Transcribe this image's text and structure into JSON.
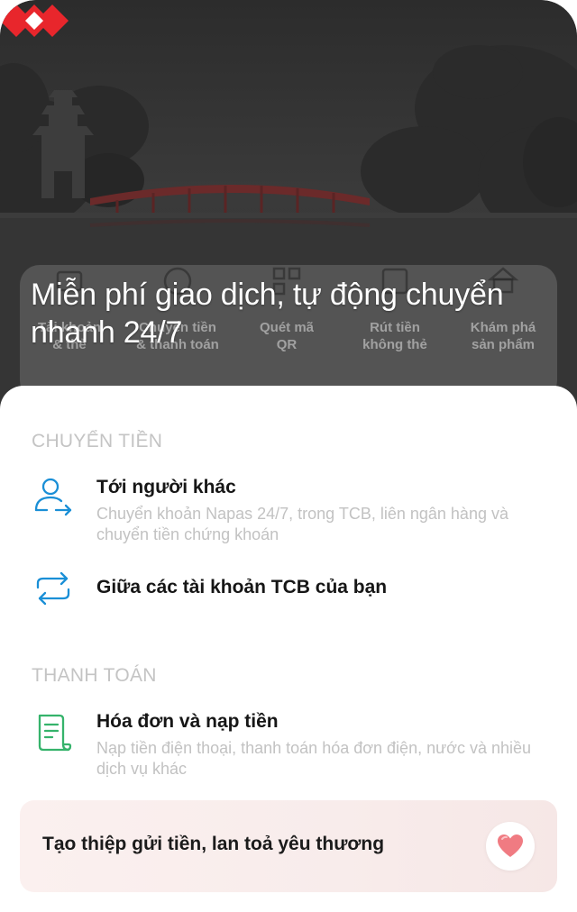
{
  "hero": {
    "title": "Miễn phí giao dịch, tự động chuyển nhanh 24/7"
  },
  "quick_actions": [
    {
      "label": "Tài khoản\n& thẻ",
      "icon": "card-icon"
    },
    {
      "label": "Chuyển tiền\n& thanh toán",
      "icon": "transfer-circle-icon"
    },
    {
      "label": "Quét mã\nQR",
      "icon": "qr-icon"
    },
    {
      "label": "Rút tiền\nkhông thẻ",
      "icon": "atm-icon"
    },
    {
      "label": "Khám phá\nsản phẩm",
      "icon": "home-explore-icon"
    }
  ],
  "sheet": {
    "transfer_section": "CHUYỂN TIỀN",
    "payment_section": "THANH TOÁN",
    "items": [
      {
        "title": "Tới người khác",
        "subtitle": "Chuyển khoản Napas 24/7, trong TCB, liên ngân hàng và chuyển tiền chứng khoán",
        "icon": "person-transfer-icon"
      },
      {
        "title": "Giữa các tài khoản TCB của bạn",
        "icon": "swap-arrows-icon"
      },
      {
        "title": "Hóa đơn và nạp tiền",
        "subtitle": "Nạp tiền điện thoại, thanh toán hóa đơn điện, nước và nhiều dịch vụ khác",
        "icon": "bill-icon"
      }
    ],
    "promo": {
      "text": "Tạo thiệp gửi tiền, lan toả yêu thương",
      "icon": "heart-icon"
    }
  },
  "colors": {
    "brand_red": "#e8262c",
    "accent_blue": "#1a8fd6",
    "accent_green": "#35b36b",
    "heart_pink": "#f07b82"
  }
}
